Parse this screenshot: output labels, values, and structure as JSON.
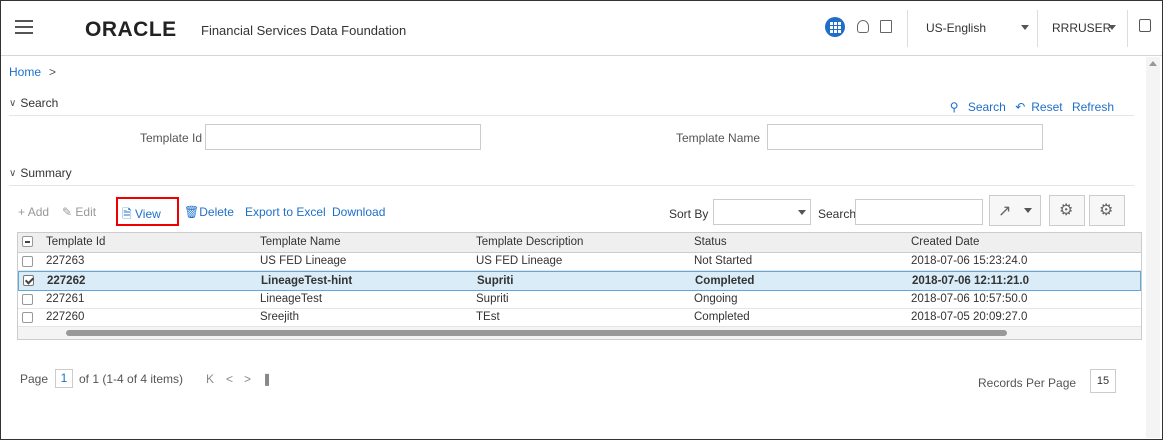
{
  "header": {
    "brand": "ORACLE",
    "product": "Financial Services Data Foundation",
    "language": "US-English",
    "user": "RRRUSER"
  },
  "breadcrumb": {
    "home": "Home",
    "chevron": ">"
  },
  "search": {
    "section_label": "Search",
    "search_link": "Search",
    "reset_link": "Reset",
    "refresh_link": "Refresh",
    "template_id_label": "Template Id",
    "template_id_value": "",
    "template_name_label": "Template Name",
    "template_name_value": ""
  },
  "summary": {
    "section_label": "Summary",
    "toolbar": {
      "add": "Add",
      "edit": "Edit",
      "view": "View",
      "delete": "Delete",
      "export": "Export to Excel",
      "download": "Download",
      "sort_by_label": "Sort By",
      "sort_by_value": "",
      "search_label": "Search",
      "search_value": ""
    },
    "columns": [
      "Template Id",
      "Template Name",
      "Template Description",
      "Status",
      "Created Date"
    ],
    "rows": [
      {
        "id": "227263",
        "name": "US FED Lineage",
        "description": "US FED Lineage",
        "status": "Not Started",
        "created": "2018-07-06 15:23:24.0",
        "selected": false
      },
      {
        "id": "227262",
        "name": "LineageTest-hint",
        "description": "Supriti",
        "status": "Completed",
        "created": "2018-07-06 12:11:21.0",
        "selected": true
      },
      {
        "id": "227261",
        "name": "LineageTest",
        "description": "Supriti",
        "status": "Ongoing",
        "created": "2018-07-06 10:57:50.0",
        "selected": false
      },
      {
        "id": "227260",
        "name": "Sreejith",
        "description": "TEst",
        "status": "Completed",
        "created": "2018-07-05 20:09:27.0",
        "selected": false
      }
    ],
    "pager": {
      "page_label": "Page",
      "page_value": "1",
      "page_info": "of 1 (1-4 of 4 items)",
      "records_per_page_label": "Records Per Page",
      "records_per_page_value": "15"
    }
  },
  "colors": {
    "accent": "#1f6fc9",
    "highlight_box": "#e00000",
    "selected_row": "#d9ecf7"
  }
}
